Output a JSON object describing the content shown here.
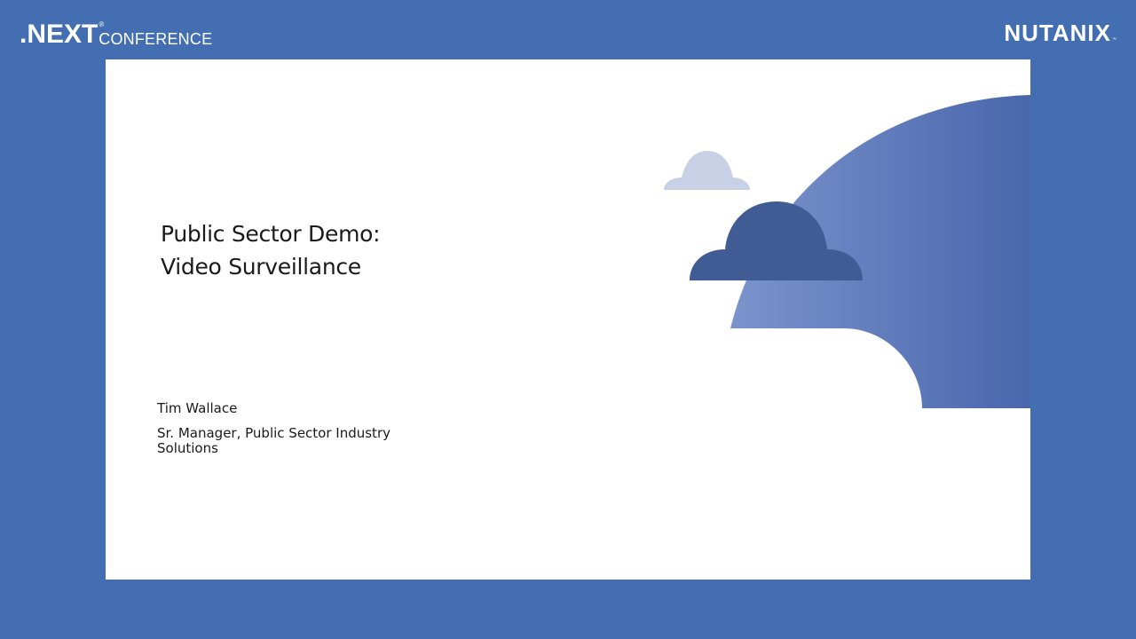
{
  "header": {
    "conference_logo": {
      "brand": ".NEXT",
      "registered": "®",
      "suffix": "CONFERENCE"
    },
    "company_logo": {
      "brand": "NUTANIX",
      "trademark": "™"
    }
  },
  "slide": {
    "title_line1": "Public Sector Demo:",
    "title_line2": "Video Surveillance",
    "presenter_name": "Tim Wallace",
    "presenter_role": "Sr. Manager, Public Sector Industry Solutions"
  },
  "colors": {
    "background": "#436fb2",
    "slide": "#ffffff",
    "hill_light": "#7b94cc",
    "hill_dark": "#4a66ad",
    "cloud_light": "#c8d0e6",
    "cloud_dark": "#415c95",
    "text": "#1a1a1a"
  },
  "icons": {
    "small_cloud": "cloud-icon",
    "large_cloud": "cloud-icon"
  }
}
